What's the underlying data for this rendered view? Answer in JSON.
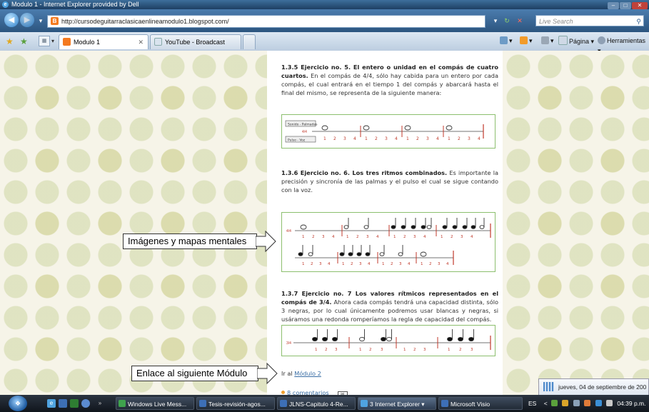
{
  "window": {
    "title": "Modulo 1 - Internet Explorer provided by Dell"
  },
  "address_bar": {
    "url": "http://cursodeguitarraclasicaenlineamodulo1.blogspot.com/",
    "search_placeholder": "Live Search"
  },
  "tabs": [
    {
      "label": "Modulo 1",
      "active": true
    },
    {
      "label": "YouTube - Broadcast Your...",
      "active": false
    }
  ],
  "command_bar": {
    "page_label": "Página",
    "tools_label": "Herramientas"
  },
  "article": {
    "sec1_title": "1.3.5 Ejercicio no. 5. El entero o unidad en el compás de cuatro cuartos.",
    "sec1_body": " En el compás de 4/4, sólo hay cabida para un entero por cada compás, el cual entrará en el tiempo 1 del compás y abarcará hasta el final del mismo, se representa de la siguiente manera:",
    "staff1": {
      "label_top": "Sonido - Palmadas",
      "time_sig": "4/4",
      "label_bottom": "Pulso - Voz",
      "beats": [
        "1",
        "2",
        "3",
        "4"
      ]
    },
    "sec2_title": "1.3.6 Ejercicio no. 6. Los tres ritmos combinados.",
    "sec2_body": " Es importante la precisión y sincronía de las palmas y el pulso el cual se sigue contando con la voz.",
    "staff2": {
      "time_sig": "4/4"
    },
    "sec3_title": "1.3.7 Ejercicio no. 7 Los valores rítmicos representados en el compás de 3/4.",
    "sec3_body": " Ahora cada compás tendrá una capacidad distinta, sólo 3 negras, por lo cual únicamente podremos usar blancas y negras, si usáramos una redonda romperíamos la regla de capacidad del compás.",
    "staff3": {
      "time_sig": "3/4"
    },
    "next_prefix": "Ir al",
    "next_link": "Módulo 2",
    "comments": "8 comentarios"
  },
  "callouts": {
    "images": "Imágenes y mapas mentales",
    "link": "Enlace al siguiente Módulo"
  },
  "notification": {
    "text": "jueves, 04 de septiembre de 200"
  },
  "taskbar": {
    "buttons": [
      {
        "label": "Windows Live Mess...",
        "color": "#3fa34d"
      },
      {
        "label": "Tesis-revisión-agos...",
        "color": "#3d6fb6"
      },
      {
        "label": "JLNS-Capitulo 4-Re...",
        "color": "#3d6fb6"
      },
      {
        "label": "3 Internet Explorer",
        "color": "#4fa3e0"
      },
      {
        "label": "Microsoft Visio",
        "color": "#3d6fb6"
      }
    ],
    "lang": "ES",
    "clock": "04:39 p.m."
  },
  "colors": {
    "accent": "#2c557f",
    "link": "#3a6ea5",
    "staff_border": "#8cbf6e",
    "barline": "#c0392b"
  }
}
